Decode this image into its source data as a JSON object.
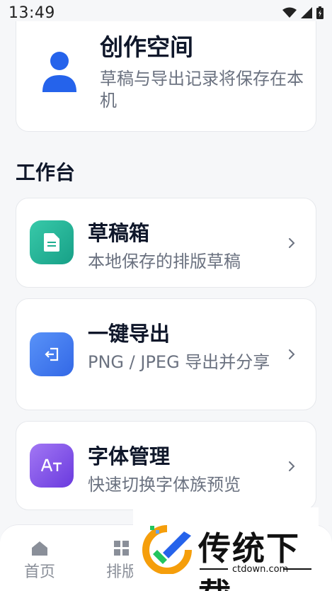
{
  "status_bar": {
    "time": "13:49"
  },
  "profile": {
    "title": "创作空间",
    "subtitle": "草稿与导出记录将保存在本机"
  },
  "section": {
    "title": "工作台"
  },
  "tools": [
    {
      "title": "草稿箱",
      "desc": "本地保存的排版草稿",
      "icon": "document-icon",
      "color_from": "#34c4a5",
      "color_to": "#1aa58a"
    },
    {
      "title": "一键导出",
      "desc": "PNG / JPEG 导出并分享",
      "icon": "export-icon",
      "color_from": "#4f8cf7",
      "color_to": "#3a6fe8"
    },
    {
      "title": "字体管理",
      "desc": "快速切换字体族预览",
      "icon": "font-icon",
      "color_from": "#9a6bf2",
      "color_to": "#6f3fe0"
    }
  ],
  "bottom_nav": {
    "items": [
      {
        "label": "首页",
        "icon": "home-icon"
      },
      {
        "label": "排版",
        "icon": "grid-icon"
      }
    ]
  },
  "watermark": {
    "title": "传统下载",
    "url": "ctdown.com"
  }
}
